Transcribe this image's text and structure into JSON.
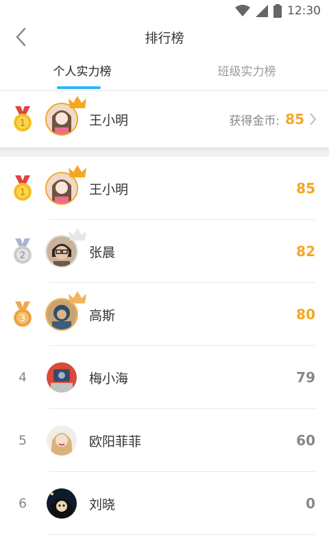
{
  "status": {
    "time": "12:30"
  },
  "header": {
    "title": "排行榜"
  },
  "tabs": [
    {
      "label": "个人实力榜",
      "active": true
    },
    {
      "label": "班级实力榜",
      "active": false
    }
  ],
  "my_rank": {
    "rank": "1",
    "name": "王小明",
    "coin_label": "获得金币:",
    "coins": "85"
  },
  "ranking": [
    {
      "rank": "1",
      "name": "王小明",
      "score": "85",
      "medal": "gold"
    },
    {
      "rank": "2",
      "name": "张晨",
      "score": "82",
      "medal": "silver"
    },
    {
      "rank": "3",
      "name": "高斯",
      "score": "80",
      "medal": "bronze"
    },
    {
      "rank": "4",
      "name": "梅小海",
      "score": "79",
      "medal": "none"
    },
    {
      "rank": "5",
      "name": "欧阳菲菲",
      "score": "60",
      "medal": "none"
    },
    {
      "rank": "6",
      "name": "刘晓",
      "score": "0",
      "medal": "none"
    }
  ],
  "colors": {
    "accent": "#29b6f6",
    "gold": "#f5a623",
    "silver": "#cfcfcf",
    "bronze": "#f2a94e"
  }
}
